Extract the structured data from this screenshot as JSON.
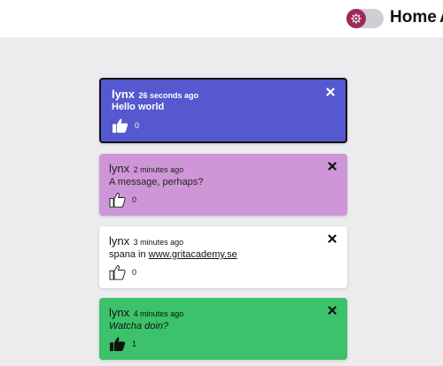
{
  "nav": {
    "home_label": "Home",
    "next_label": "A",
    "toggle_icon": "gear-icon"
  },
  "colors": {
    "card_1": "#5558cf",
    "card_2": "#cf96d7",
    "card_3": "#ffffff",
    "card_4": "#3cc26a",
    "toggle_knob": "#9b2a5b"
  },
  "messages": [
    {
      "user": "lynx",
      "time": "26 seconds ago",
      "text": "Hello world",
      "likes": "0",
      "liked": true
    },
    {
      "user": "lynx",
      "time": "2 minutes ago",
      "text": "A message, perhaps?",
      "likes": "0",
      "liked": false
    },
    {
      "user": "lynx",
      "time": "3 minutes ago",
      "text_prefix": "spana in ",
      "link": "www.gritacademy.se",
      "likes": "0",
      "liked": false
    },
    {
      "user": "lynx",
      "time": "4 minutes ago",
      "text": "Watcha doin?",
      "likes": "1",
      "liked": true
    }
  ]
}
